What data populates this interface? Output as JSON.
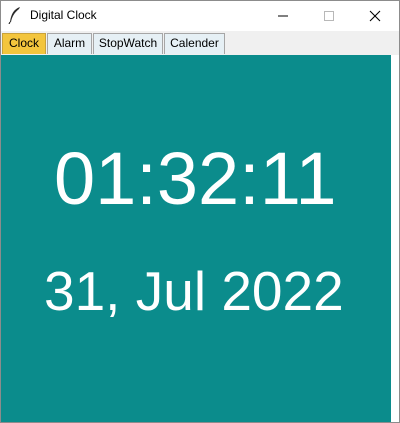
{
  "window": {
    "title": "Digital Clock",
    "app_icon": "feather-icon"
  },
  "window_controls": {
    "minimize_icon": "minimize-icon",
    "maximize_icon": "maximize-icon",
    "close_icon": "close-icon"
  },
  "tabs": [
    {
      "label": "Clock",
      "selected": true
    },
    {
      "label": "Alarm",
      "selected": false
    },
    {
      "label": "StopWatch",
      "selected": false
    },
    {
      "label": "Calender",
      "selected": false
    }
  ],
  "clock": {
    "time": "01:32:11",
    "date": "31, Jul 2022"
  },
  "colors": {
    "background": "#0b8c8c",
    "text": "#ffffff",
    "active_tab": "#f3c53d",
    "inactive_tab": "#e6f0f5"
  }
}
